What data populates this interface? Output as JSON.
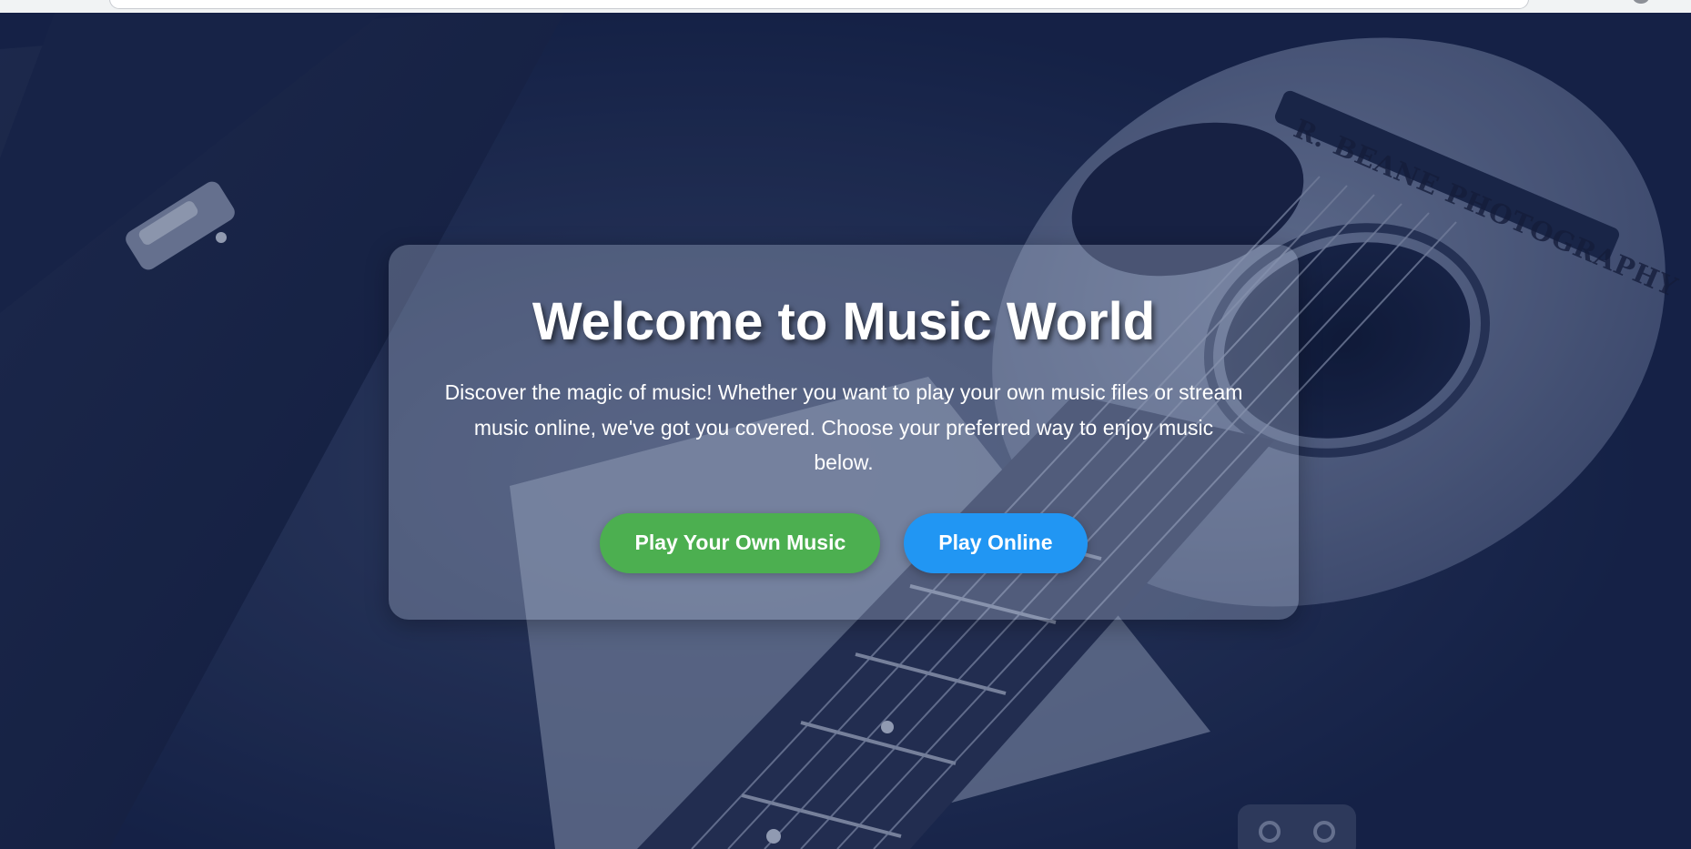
{
  "hero": {
    "watermark": "R. BEANE PHOTOGRAPHY"
  },
  "welcome": {
    "title": "Welcome to Music World",
    "description": "Discover the magic of music! Whether you want to play your own music files or stream music online, we've got you covered. Choose your preferred way to enjoy music below.",
    "buttons": {
      "own_label": "Play Your Own Music",
      "online_label": "Play Online"
    }
  },
  "colors": {
    "own_button": "#4caf50",
    "online_button": "#2196f3",
    "overlay": "#1a2548"
  }
}
